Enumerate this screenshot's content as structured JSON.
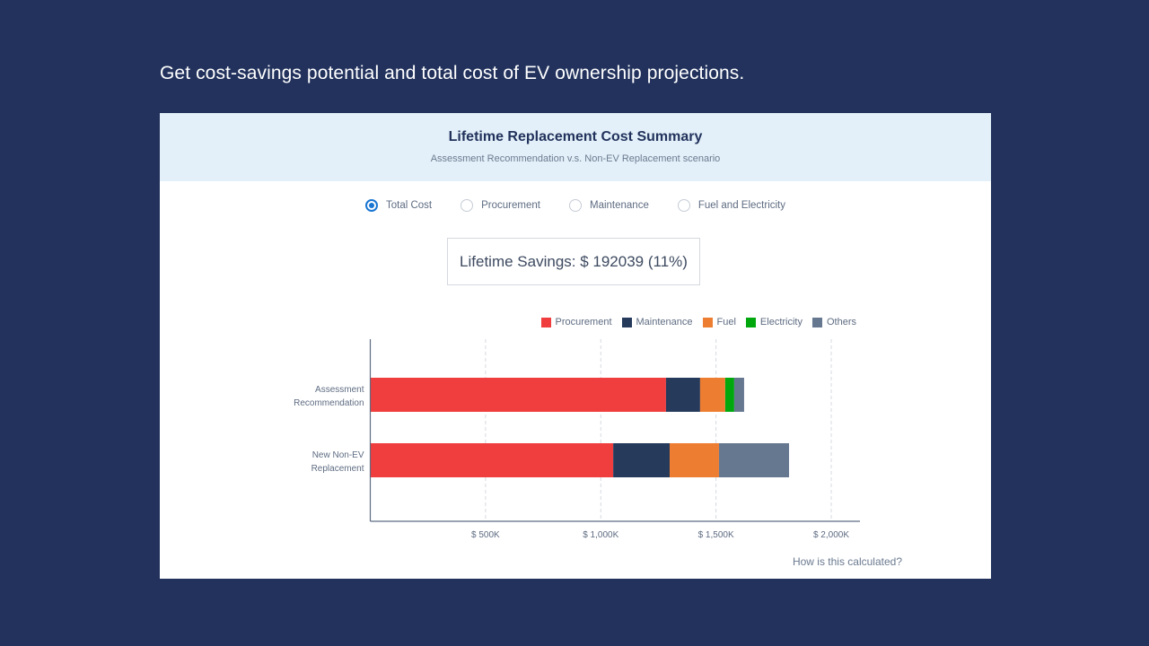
{
  "headline": "Get cost-savings potential and total cost of EV ownership projections.",
  "card": {
    "title": "Lifetime Replacement Cost Summary",
    "subtitle": "Assessment Recommendation v.s. Non-EV Replacement scenario"
  },
  "radio_options": [
    {
      "label": "Total Cost",
      "selected": true
    },
    {
      "label": "Procurement",
      "selected": false
    },
    {
      "label": "Maintenance",
      "selected": false
    },
    {
      "label": "Fuel and Electricity",
      "selected": false
    }
  ],
  "savings": {
    "text": "Lifetime Savings: $ 192039 (11%)",
    "amount": 192039,
    "percent": 11
  },
  "help_link": "How is this calculated?",
  "colors": {
    "background": "#22325c",
    "accent": "#1976d2"
  },
  "chart_data": {
    "type": "bar",
    "orientation": "horizontal",
    "stacked": true,
    "title": "",
    "xlabel": "",
    "ylabel": "",
    "unit": "$K",
    "xlim": [
      0,
      2100
    ],
    "x_ticks": [
      500,
      1000,
      1500,
      2000
    ],
    "x_tick_labels": [
      "$ 500K",
      "$ 1,000K",
      "$ 1,500K",
      "$ 2,000K"
    ],
    "grid": "vertical dashed",
    "legend_position": "top-right",
    "categories": [
      [
        "Assessment",
        "Recommendation"
      ],
      [
        "New Non-EV",
        "Replacement"
      ]
    ],
    "series": [
      {
        "name": "Procurement",
        "color": "#f03e3e",
        "values": [
          1283,
          1054
        ]
      },
      {
        "name": "Maintenance",
        "color": "#263a5c",
        "values": [
          148,
          245
        ]
      },
      {
        "name": "Fuel",
        "color": "#ed7d31",
        "values": [
          109,
          214
        ]
      },
      {
        "name": "Electricity",
        "color": "#00a80e",
        "values": [
          39,
          0
        ]
      },
      {
        "name": "Others",
        "color": "#667890",
        "values": [
          43,
          304
        ]
      }
    ]
  }
}
